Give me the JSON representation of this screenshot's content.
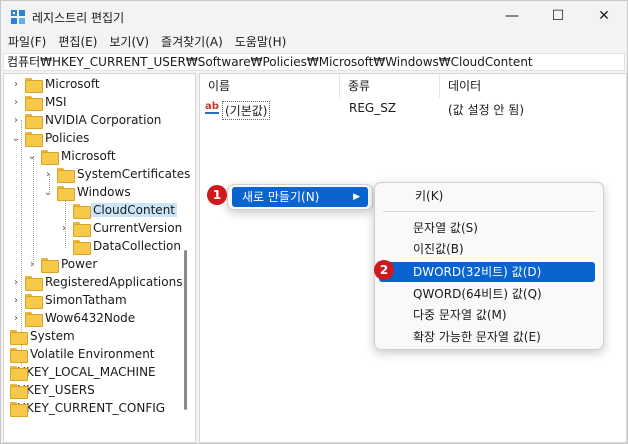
{
  "titlebar": {
    "title": "레지스트리 편집기",
    "minimize": "—",
    "maximize": "☐",
    "close": "✕"
  },
  "menubar": [
    "파일(F)",
    "편집(E)",
    "보기(V)",
    "즐겨찾기(A)",
    "도움말(H)"
  ],
  "address": "컴퓨터₩HKEY_CURRENT_USER₩Software₩Policies₩Microsoft₩Windows₩CloudContent",
  "tree": [
    {
      "label": "Microsoft"
    },
    {
      "label": "MSI"
    },
    {
      "label": "NVIDIA Corporation"
    },
    {
      "label": "Policies"
    },
    {
      "label": "Microsoft"
    },
    {
      "label": "SystemCertificates"
    },
    {
      "label": "Windows"
    },
    {
      "label": "CloudContent"
    },
    {
      "label": "CurrentVersion"
    },
    {
      "label": "DataCollection"
    },
    {
      "label": "Power"
    },
    {
      "label": "RegisteredApplications"
    },
    {
      "label": "SimonTatham"
    },
    {
      "label": "Wow6432Node"
    },
    {
      "label": "System"
    },
    {
      "label": "Volatile Environment"
    },
    {
      "label": "HKEY_LOCAL_MACHINE"
    },
    {
      "label": "HKEY_USERS"
    },
    {
      "label": "HKEY_CURRENT_CONFIG"
    }
  ],
  "columns": [
    "이름",
    "종류",
    "데이터"
  ],
  "values": [
    {
      "name": "(기본값)",
      "type": "REG_SZ",
      "data": "(값 설정 안 됨)"
    }
  ],
  "context_menu": {
    "new_label": "새로 만들기(N)",
    "badge": "1"
  },
  "submenu": {
    "key": "키(K)",
    "string": "문자열 값(S)",
    "binary": "이진값(B)",
    "dword": "DWORD(32비트) 값(D)",
    "qword": "QWORD(64비트) 값(Q)",
    "multi": "다중 문자열 값(M)",
    "expand": "확장 가능한 문자열 값(E)",
    "badge": "2"
  },
  "colors": {
    "highlight": "#0a64d0",
    "badge": "#d0181f",
    "selection": "#cce4f7"
  }
}
